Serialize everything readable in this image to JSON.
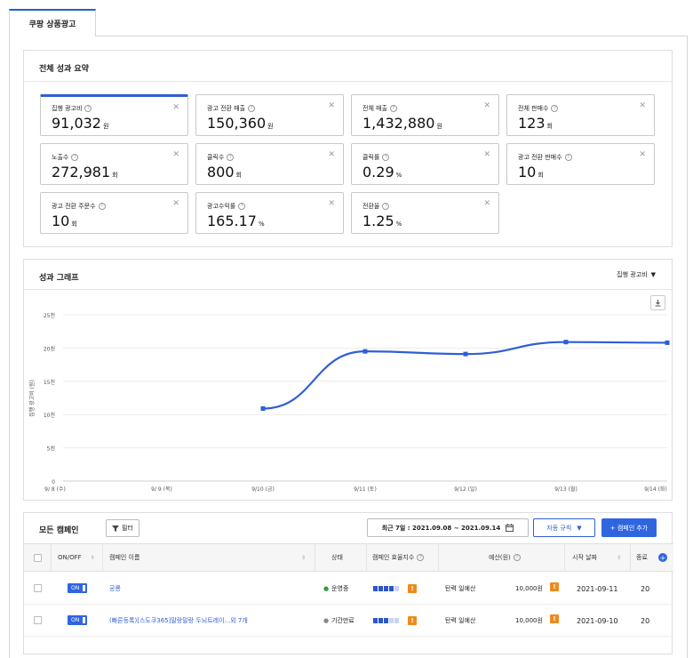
{
  "tab": {
    "label": "쿠팡 상품광고"
  },
  "summary": {
    "title": "전체 성과 요약",
    "cards": [
      {
        "label": "집행 광고비",
        "value": "91,032",
        "unit": "원",
        "active": true
      },
      {
        "label": "광고 전환 매출",
        "value": "150,360",
        "unit": "원"
      },
      {
        "label": "전체 매출",
        "value": "1,432,880",
        "unit": "원"
      },
      {
        "label": "전체 판매수",
        "value": "123",
        "unit": "회"
      },
      {
        "label": "노출수",
        "value": "272,981",
        "unit": "회"
      },
      {
        "label": "클릭수",
        "value": "800",
        "unit": "회"
      },
      {
        "label": "클릭률",
        "value": "0.29",
        "unit": "%"
      },
      {
        "label": "광고 전환 판매수",
        "value": "10",
        "unit": "회"
      },
      {
        "label": "광고 전환 주문수",
        "value": "10",
        "unit": "회"
      },
      {
        "label": "광고수익률",
        "value": "165.17",
        "unit": "%"
      },
      {
        "label": "전환율",
        "value": "1.25",
        "unit": "%"
      }
    ]
  },
  "graph": {
    "title": "성과 그래프",
    "metric_select": "집행 광고비"
  },
  "chart_data": {
    "type": "line",
    "ylabel": "집행 광고비 (원)",
    "yticks": [
      "0",
      "5천",
      "10천",
      "15천",
      "20천",
      "25천"
    ],
    "ylim": [
      0,
      25000
    ],
    "categories": [
      "9/ 8 (수)",
      "9/ 9 (목)",
      "9/10 (금)",
      "9/11 (토)",
      "9/12 (일)",
      "9/13 (월)",
      "9/14 (화)"
    ],
    "values": [
      null,
      null,
      10900,
      19500,
      19100,
      20900,
      20800
    ],
    "color": "#2f5ed6",
    "grid": true
  },
  "campaigns": {
    "title": "모든 캠페인",
    "filter_label": "필터",
    "date_range": "최근 7일 : 2021.09.08 ~ 2021.09.14",
    "auto_rule_label": "자동 규칙",
    "add_label": "+ 캠페인 추가",
    "headers": {
      "onoff": "ON/OFF",
      "name": "캠페인 이름",
      "status": "상태",
      "efficiency": "캠페인 효율지수",
      "budget": "예산(원)",
      "start": "시작 날짜",
      "end": "종료"
    },
    "rows": [
      {
        "toggle": "ON",
        "name": "공룡",
        "status": "운영중",
        "status_color": "#2e9e3e",
        "eff_level": 4,
        "budget_type": "탄력 일예산",
        "budget": "10,000원",
        "start": "2021-09-11",
        "end": "20"
      },
      {
        "toggle": "ON",
        "name": "(빠른등록)[스도쿠365]말랑말랑 두뇌트레이...외 7개",
        "status": "기간만료",
        "status_color": "#888888",
        "eff_level": 3,
        "budget_type": "탄력 일예산",
        "budget": "10,000원",
        "start": "2021-09-10",
        "end": "20"
      }
    ]
  },
  "colors": {
    "accent": "#2f5ed6",
    "warning": "#f08a1c"
  }
}
